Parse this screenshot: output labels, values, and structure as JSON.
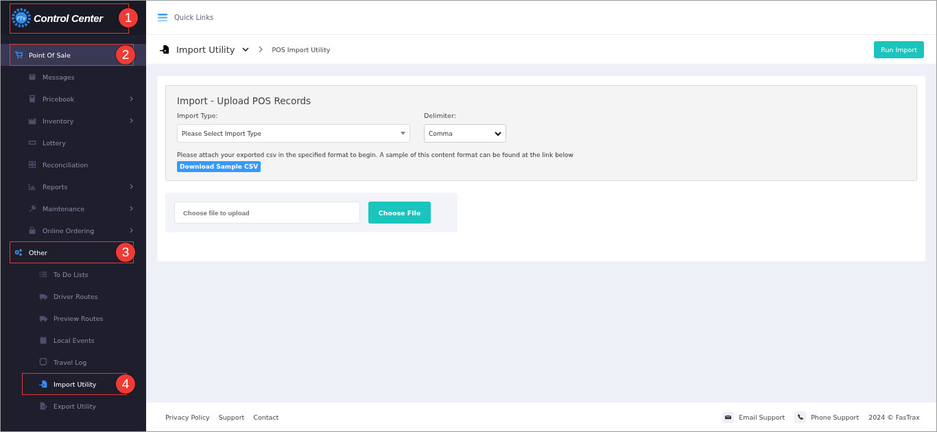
{
  "logo": {
    "title": "Control Center",
    "badge_text": "FTx",
    "callout": "1"
  },
  "sidebar": {
    "items": [
      {
        "label": "Point Of Sale",
        "kind": "section",
        "selected": true,
        "callout": "2",
        "children": [
          {
            "label": "Messages",
            "submenu": false,
            "selected": false
          },
          {
            "label": "Pricebook",
            "submenu": true,
            "selected": false
          },
          {
            "label": "Inventory",
            "submenu": true,
            "selected": false
          },
          {
            "label": "Lottery",
            "submenu": false,
            "selected": false
          },
          {
            "label": "Reconciliation",
            "submenu": false,
            "selected": false
          },
          {
            "label": "Reports",
            "submenu": true,
            "selected": false
          },
          {
            "label": "Maintenance",
            "submenu": true,
            "selected": false
          },
          {
            "label": "Online Ordering",
            "submenu": true,
            "selected": false
          }
        ]
      },
      {
        "label": "Other",
        "kind": "section",
        "selected": false,
        "callout": "3",
        "children": [
          {
            "label": "To Do Lists",
            "submenu": false,
            "selected": false
          },
          {
            "label": "Driver Routes",
            "submenu": false,
            "selected": false
          },
          {
            "label": "Preview Routes",
            "submenu": false,
            "selected": false
          },
          {
            "label": "Local Events",
            "submenu": false,
            "selected": false
          },
          {
            "label": "Travel Log",
            "submenu": false,
            "selected": false
          },
          {
            "label": "Import Utility",
            "submenu": false,
            "selected": true,
            "callout": "4"
          },
          {
            "label": "Export Utility",
            "submenu": false,
            "selected": false
          }
        ]
      }
    ]
  },
  "topbar": {
    "quick_links": "Quick Links"
  },
  "subheader": {
    "title": "Import Utility",
    "breadcrumb": "POS Import Utility",
    "action": "Run Import"
  },
  "form": {
    "title": "Import - Upload POS Records",
    "import_type_label": "Import Type:",
    "import_type_value": "Please Select Import Type",
    "delimiter_label": "Delimiter:",
    "delimiter_value": "Comma",
    "hint": "Please attach your exported csv in the specified format to begin. A sample of this content format can be found at the link below",
    "sample_button": "Download Sample CSV",
    "file_placeholder": "Choose file to upload",
    "file_button": "Choose File"
  },
  "footer": {
    "links": [
      "Privacy Policy",
      "Support",
      "Contact"
    ],
    "email": "Email Support",
    "phone": "Phone Support",
    "copyright": "2024 © FasTrax"
  }
}
